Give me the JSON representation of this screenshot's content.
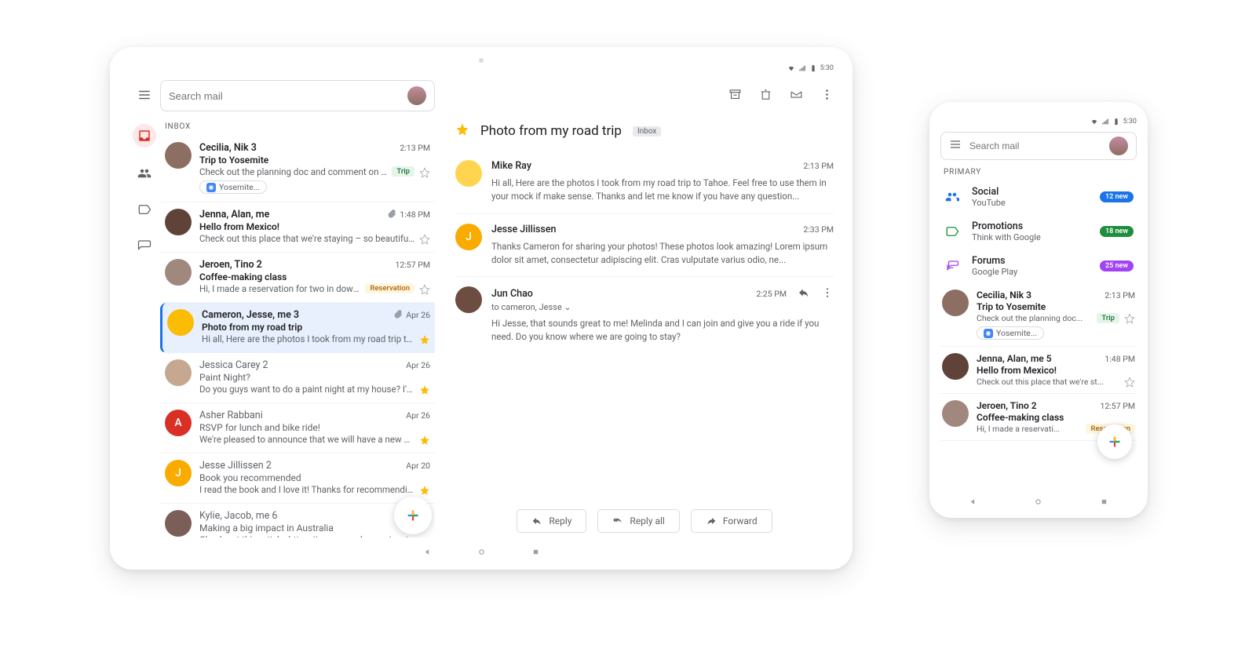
{
  "status": {
    "time": "5:30"
  },
  "tablet": {
    "search_placeholder": "Search mail",
    "section_label": "Inbox",
    "threads": [
      {
        "who": "Cecilia, Nik 3",
        "when": "2:13 PM",
        "subject": "Trip to Yosemite",
        "snippet": "Check out the planning doc and comment on your...",
        "chip": "Yosemite...",
        "tag": "Trip",
        "tagClass": "trip",
        "star": "empty",
        "attach": false,
        "read": false,
        "avBg": "#8d6e63",
        "avTxt": ""
      },
      {
        "who": "Jenna, Alan, me",
        "when": "1:48 PM",
        "subject": "Hello from Mexico!",
        "snippet": "Check out this place that we're staying – so beautiful! Mo...",
        "star": "empty",
        "attach": true,
        "read": false,
        "avBg": "#5f4339",
        "avTxt": ""
      },
      {
        "who": "Jeroen, Tino 2",
        "when": "12:57 PM",
        "subject": "Coffee-making class",
        "snippet": "Hi, I made a reservation for two in downtown…",
        "tag": "Reservation",
        "tagClass": "resv",
        "star": "empty",
        "attach": false,
        "read": false,
        "avBg": "#a1887f",
        "avTxt": ""
      },
      {
        "who": "Cameron, Jesse, me 3",
        "when": "Apr 26",
        "subject": "Photo from my road trip",
        "snippet": "Hi all, Here are the photos I took from my road trip to Ta...",
        "star": "filled",
        "attach": true,
        "read": false,
        "selected": true,
        "avBg": "#fbbc04",
        "avTxt": ""
      },
      {
        "who": "Jessica Carey 2",
        "when": "Apr 26",
        "subject": "Paint Night?",
        "snippet": "Do you guys want to do a paint night at my house? I'm thi...",
        "star": "filled",
        "read": true,
        "avBg": "#c5a88f",
        "avTxt": ""
      },
      {
        "who": "Asher Rabbani",
        "when": "Apr 26",
        "subject": "RSVP for lunch and bike ride!",
        "snippet": "We're pleased to announce that we will have a new plan...",
        "star": "filled",
        "read": true,
        "avBg": "#d93025",
        "avTxt": "A"
      },
      {
        "who": "Jesse Jillissen 2",
        "when": "Apr 20",
        "subject": "Book you recommended",
        "snippet": "I read the book and I love it! Thanks for recommending...",
        "star": "filled",
        "read": true,
        "avBg": "#f9ab00",
        "avTxt": "J"
      },
      {
        "who": "Kylie, Jacob, me 6",
        "when": "",
        "subject": "Making a big impact in Australia",
        "snippet": "Check out this article: https://www.google.com/austra...",
        "star": "",
        "read": true,
        "avBg": "#7b5e57",
        "avTxt": ""
      }
    ],
    "detail": {
      "subject": "Photo from my road trip",
      "label": "Inbox",
      "messages": [
        {
          "from": "Mike Ray",
          "time": "2:13 PM",
          "body": "Hi all, Here are the photos I took from my road trip to Tahoe. Feel free to use them in your mock if make sense. Thanks and let me know if you have any question...",
          "avBg": "#ffd54f",
          "avTxt": ""
        },
        {
          "from": "Jesse Jillissen",
          "time": "2:33 PM",
          "body": "Thanks Cameron for sharing your photos! These photos look amazing! Lorem ipsum dolor sit amet, consectetur adipiscing elit. Cras vulputate varius odio, ne...",
          "avBg": "#f9ab00",
          "avTxt": "J"
        },
        {
          "from": "Jun Chao",
          "time": "2:25 PM",
          "to": "to cameron, Jesse",
          "body": "Hi Jesse, that sounds great to me! Melinda and I can join and give you a ride if you need. Do you know where we are going to stay?",
          "avBg": "#6d4c41",
          "avTxt": "",
          "actions": true
        }
      ],
      "reply": "Reply",
      "replyall": "Reply all",
      "forward": "Forward"
    }
  },
  "phone": {
    "search_placeholder": "Search mail",
    "section_label": "Primary",
    "categories": [
      {
        "name": "Social",
        "sub": "YouTube",
        "badge": "12 new",
        "badgeClass": "blue",
        "iconColor": "#1a73e8"
      },
      {
        "name": "Promotions",
        "sub": "Think with Google",
        "badge": "18 new",
        "badgeClass": "green",
        "iconColor": "#1e8e3e"
      },
      {
        "name": "Forums",
        "sub": "Google Play",
        "badge": "25 new",
        "badgeClass": "purple",
        "iconColor": "#a142f4"
      }
    ],
    "threads": [
      {
        "who": "Cecilia, Nik 3",
        "when": "2:13 PM",
        "subject": "Trip to Yosemite",
        "snippet": "Check out the planning doc...",
        "tag": "Trip",
        "tagClass": "trip",
        "chip": "Yosemite...",
        "star": "empty",
        "avBg": "#8d6e63"
      },
      {
        "who": "Jenna, Alan, me 5",
        "when": "1:48 PM",
        "subject": "Hello from Mexico!",
        "snippet": "Check out this place that we're st...",
        "star": "empty",
        "avBg": "#5f4339"
      },
      {
        "who": "Jeroen, Tino 2",
        "when": "12:57 PM",
        "subject": "Coffee-making class",
        "snippet": "Hi, I made a reservati...",
        "tag": "Reservation",
        "tagClass": "resv",
        "avBg": "#a1887f"
      }
    ]
  }
}
